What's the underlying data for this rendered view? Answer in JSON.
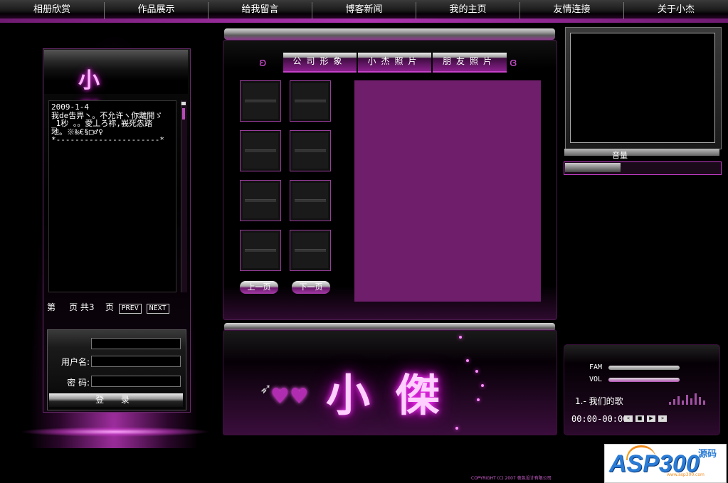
{
  "nav": {
    "items": [
      "相册欣赏",
      "作品展示",
      "给我留言",
      "博客新闻",
      "我的主页",
      "友情连接",
      "关于小杰"
    ]
  },
  "left": {
    "title": "小 傑",
    "notice": "2009-1-4\n我de吿畀丶。不允许ヽ你離開ゞ\n_1秒 。。愛丄ろ祢,峩死怣踏\n地。※‰€§□♂♀\n*----------------------*",
    "pager": {
      "p1": "第",
      "p2": "页 共3",
      "p3": "页",
      "prev": "PREV",
      "next": "NEXT"
    },
    "login": {
      "user_label": "用户名:",
      "pass_label": "密 码:",
      "submit": "登 录"
    }
  },
  "gallery": {
    "tabs": [
      "公司形象",
      "小杰照片",
      "朋友照片"
    ],
    "prev_page": "上一页",
    "next_page": "下一页"
  },
  "banner": {
    "title": "小傑"
  },
  "video": {
    "volume_label": "音量",
    "volume_level": 0.36
  },
  "player": {
    "fam_label": "FAM",
    "vol_label": "VOL",
    "song": "1.- 我们的歌",
    "time": "00:00-00:00",
    "buttons": [
      "«",
      "■",
      "▶",
      "»"
    ]
  },
  "footer": {
    "copyright": "COPYRIGHT (C) 2007 夜色设计有限公司"
  },
  "logo": {
    "text": "ASP300",
    "cn": "源码",
    "url": "www.asp300.com"
  },
  "colors": {
    "accent": "#c33cc6",
    "photo_bg": "#6e1e6b"
  }
}
